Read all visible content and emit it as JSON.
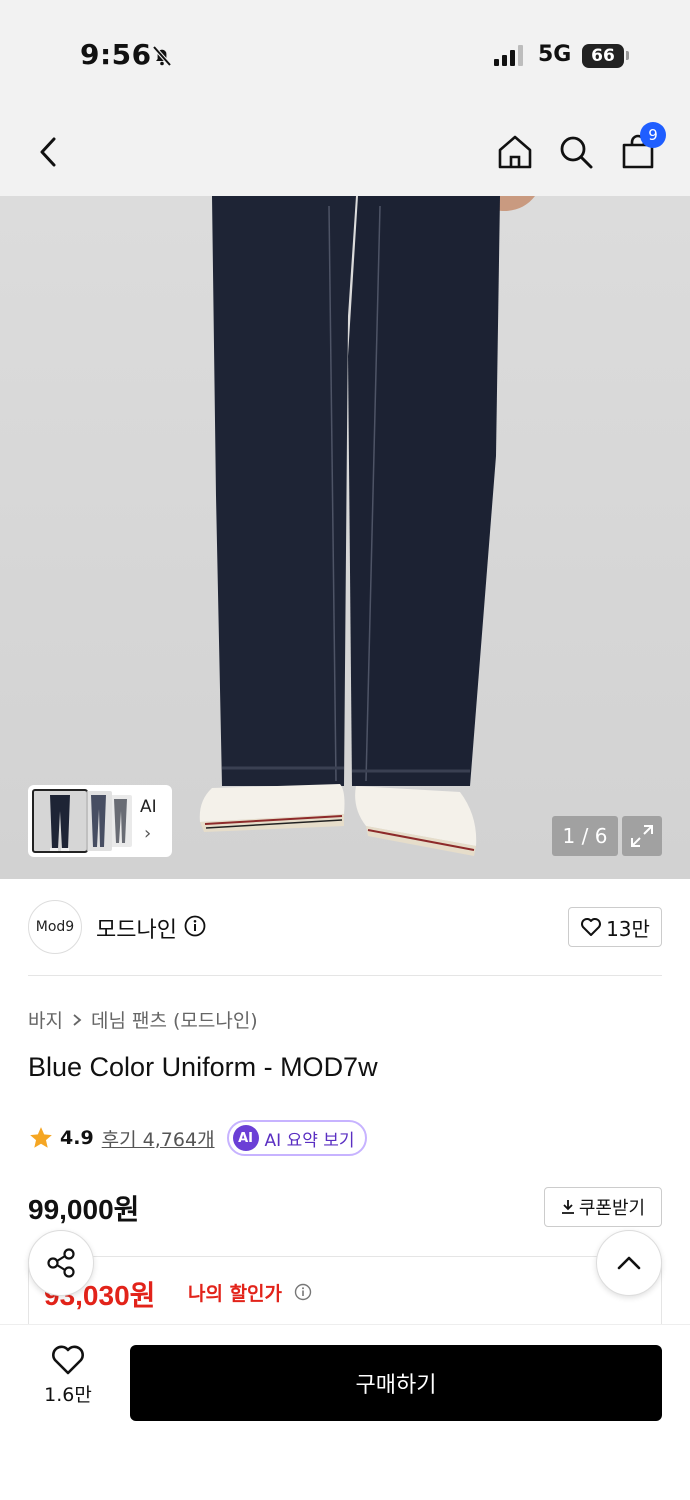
{
  "status_bar": {
    "time": "9:56",
    "network": "5G",
    "battery": "66"
  },
  "nav": {
    "cart_count": "9"
  },
  "gallery": {
    "ai_label": "AI",
    "counter": "1 / 6"
  },
  "brand": {
    "logo_text": "Mod9",
    "name": "모드나인",
    "likes": "13만"
  },
  "breadcrumb": [
    "바지",
    "데님 팬츠 (모드나인)"
  ],
  "product": {
    "title": "Blue Color Uniform - MOD7w",
    "rating": "4.9",
    "reviews": "후기 4,764개",
    "ai_summary_badge": "AI",
    "ai_summary": "AI 요약 보기",
    "price": "99,000원",
    "coupon_label": "쿠폰받기",
    "discount_price": "93,030원",
    "discount_label": "나의 할인가"
  },
  "bottom_bar": {
    "wish_count": "1.6만",
    "buy_label": "구매하기"
  },
  "colors": {
    "accent_red": "#e2231a",
    "badge_blue": "#1f5eff",
    "ai_purple": "#6b3fd6",
    "star": "#f5a623"
  }
}
